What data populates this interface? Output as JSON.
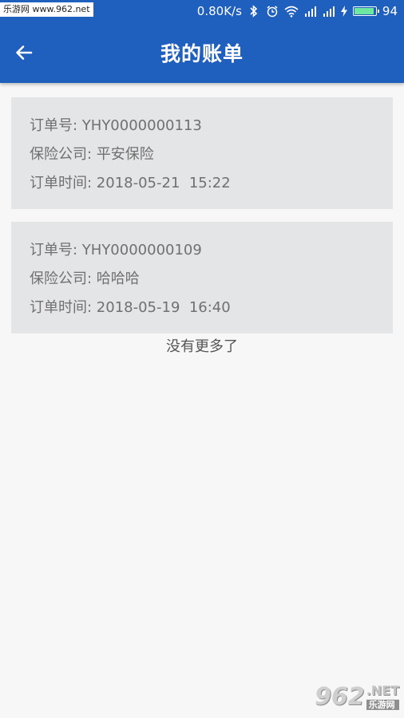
{
  "status_bar": {
    "watermark": "乐游网 www.962.net",
    "network_speed": "0.80K/s",
    "battery_level": "94",
    "battery_fraction": 0.94,
    "battery_color": "#6ee7a0",
    "icons": [
      "bluetooth-icon",
      "alarm-icon",
      "wifi-icon",
      "signal-icon",
      "signal-icon",
      "charging-icon",
      "battery-icon"
    ]
  },
  "app_bar": {
    "back_icon": "arrow-left-icon",
    "title": "我的账单",
    "color": "#1f5fbd"
  },
  "orders": [
    {
      "order_no": "订单号: YHY0000000113",
      "insurer": "保险公司: 平安保险",
      "time": "订单时间: 2018-05-21  15:22"
    },
    {
      "order_no": "订单号: YHY0000000109",
      "insurer": "保险公司: 哈哈哈",
      "time": "订单时间: 2018-05-19  16:40"
    }
  ],
  "footer_text": "没有更多了",
  "watermark_logo": {
    "number": "962",
    "suffix": ".NET",
    "name": "乐游网"
  }
}
